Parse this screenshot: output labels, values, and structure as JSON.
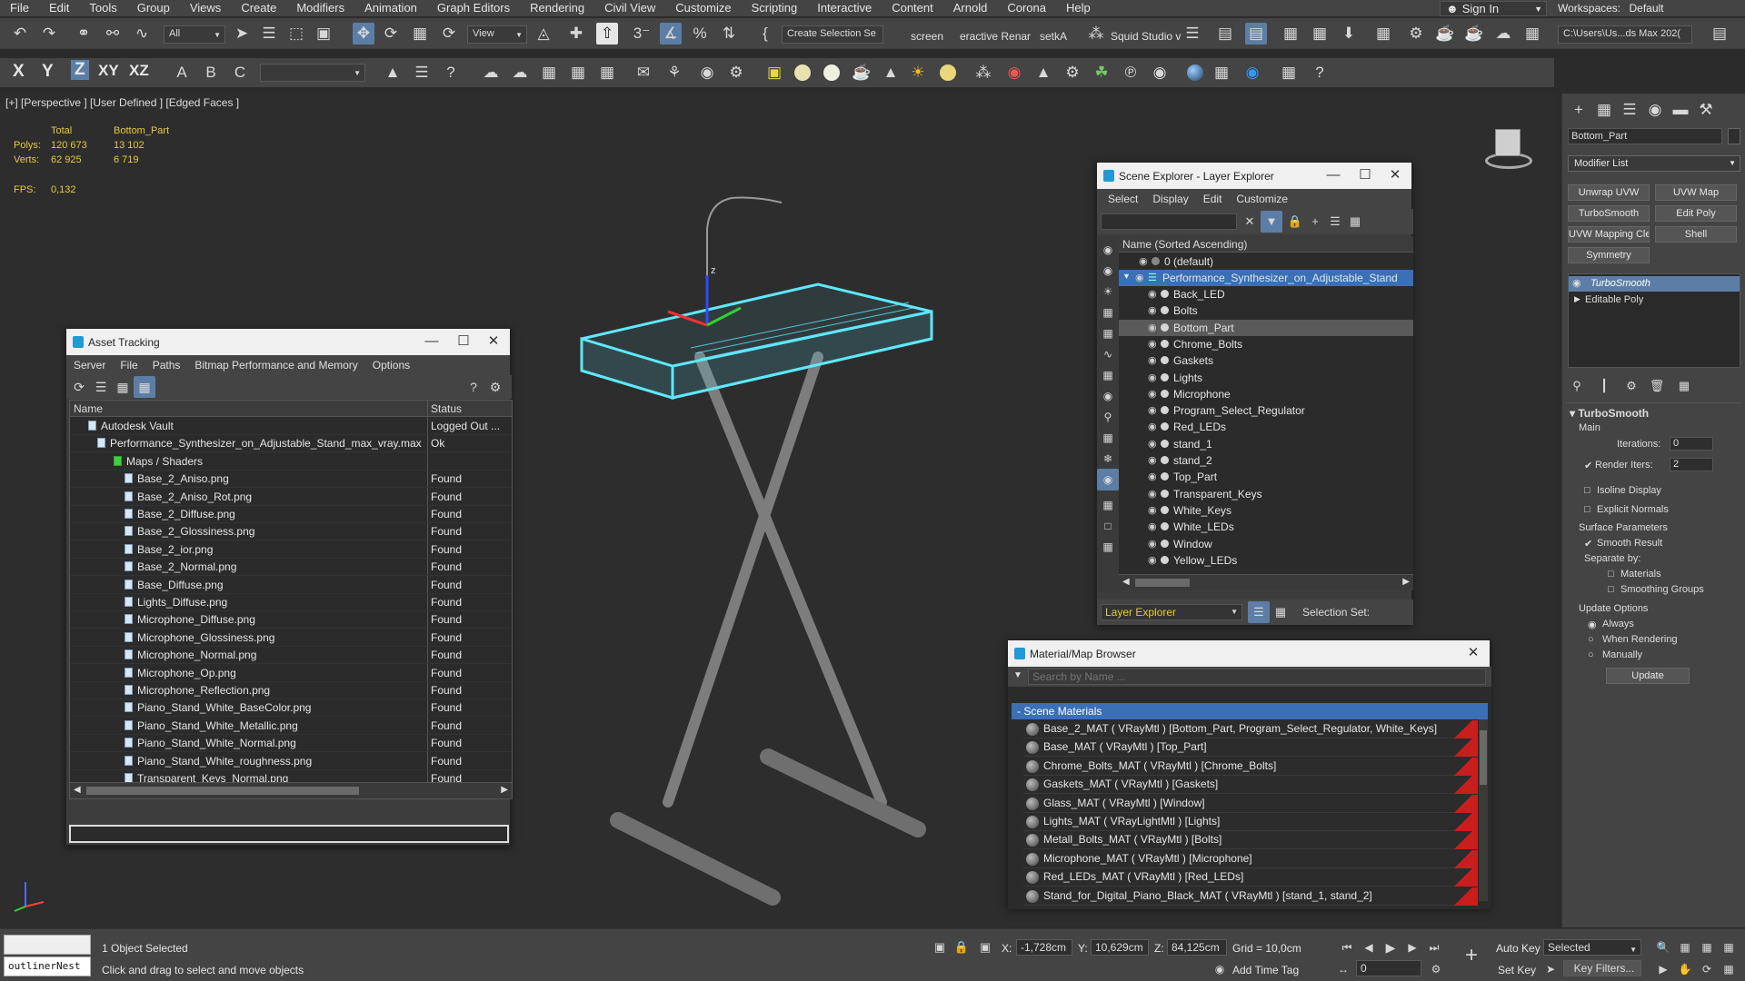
{
  "menubar": {
    "items": [
      "File",
      "Edit",
      "Tools",
      "Group",
      "Views",
      "Create",
      "Modifiers",
      "Animation",
      "Graph Editors",
      "Rendering",
      "Civil View",
      "Customize",
      "Scripting",
      "Interactive",
      "Content",
      "Arnold",
      "Corona",
      "Help"
    ],
    "sign_in": "Sign In",
    "workspaces_label": "Workspaces:",
    "workspace_value": "Default"
  },
  "toolbar": {
    "filter_dropdown": "All",
    "view_dropdown": "View",
    "selection_set": "Create Selection Se",
    "tab_screen": "screen",
    "tab_interactive": "eractive Renar",
    "tab_setka": "setkA",
    "squid_label": "Squid Studio v",
    "path_dropdown": "C:\\Users\\Us...ds Max 202(",
    "axis_x": "X",
    "axis_y": "Y",
    "axis_z": "Z",
    "axis_xy": "XY",
    "axis_xz": "XZ"
  },
  "viewport": {
    "label": "[+] [Perspective ] [User Defined ] [Edged Faces ]",
    "stats": {
      "total_header": "Total",
      "object_header": "Bottom_Part",
      "polys_label": "Polys:",
      "polys_total": "120 673",
      "polys_object": "13 102",
      "verts_label": "Verts:",
      "verts_total": "62 925",
      "verts_object": "6 719",
      "fps_label": "FPS:",
      "fps_value": "0,132"
    },
    "gizmo_z_label": "z",
    "keyboard_color": "#5ee8ff",
    "stand_color": "#8a8a8a"
  },
  "asset_tracking": {
    "title": "Asset Tracking",
    "menu": [
      "Server",
      "File",
      "Paths",
      "Bitmap Performance and Memory",
      "Options"
    ],
    "col_name": "Name",
    "col_status": "Status",
    "rows": [
      {
        "name": "Autodesk Vault",
        "status": "Logged Out ..."
      },
      {
        "name": "Performance_Synthesizer_on_Adjustable_Stand_max_vray.max",
        "status": "Ok"
      },
      {
        "name": "Maps / Shaders",
        "status": ""
      },
      {
        "name": "Base_2_Aniso.png",
        "status": "Found"
      },
      {
        "name": "Base_2_Aniso_Rot.png",
        "status": "Found"
      },
      {
        "name": "Base_2_Diffuse.png",
        "status": "Found"
      },
      {
        "name": "Base_2_Glossiness.png",
        "status": "Found"
      },
      {
        "name": "Base_2_ior.png",
        "status": "Found"
      },
      {
        "name": "Base_2_Normal.png",
        "status": "Found"
      },
      {
        "name": "Base_Diffuse.png",
        "status": "Found"
      },
      {
        "name": "Lights_Diffuse.png",
        "status": "Found"
      },
      {
        "name": "Microphone_Diffuse.png",
        "status": "Found"
      },
      {
        "name": "Microphone_Glossiness.png",
        "status": "Found"
      },
      {
        "name": "Microphone_Normal.png",
        "status": "Found"
      },
      {
        "name": "Microphone_Op.png",
        "status": "Found"
      },
      {
        "name": "Microphone_Reflection.png",
        "status": "Found"
      },
      {
        "name": "Piano_Stand_White_BaseColor.png",
        "status": "Found"
      },
      {
        "name": "Piano_Stand_White_Metallic.png",
        "status": "Found"
      },
      {
        "name": "Piano_Stand_White_Normal.png",
        "status": "Found"
      },
      {
        "name": "Piano_Stand_White_roughness.png",
        "status": "Found"
      },
      {
        "name": "Transparent_Keys_Normal.png",
        "status": "Found"
      }
    ]
  },
  "scene_explorer": {
    "title": "Scene Explorer - Layer Explorer",
    "menu": [
      "Select",
      "Display",
      "Edit",
      "Customize"
    ],
    "column_header": "Name (Sorted Ascending)",
    "default_layer": "0 (default)",
    "parent_layer": "Performance_Synthesizer_on_Adjustable_Stand",
    "children": [
      "Back_LED",
      "Bolts",
      "Bottom_Part",
      "Chrome_Bolts",
      "Gaskets",
      "Lights",
      "Microphone",
      "Program_Select_Regulator",
      "Red_LEDs",
      "stand_1",
      "stand_2",
      "Top_Part",
      "Transparent_Keys",
      "White_Keys",
      "White_LEDs",
      "Window",
      "Yellow_LEDs"
    ],
    "footer_dropdown": "Layer Explorer",
    "selection_set_label": "Selection Set:"
  },
  "material_browser": {
    "title": "Material/Map Browser",
    "search_placeholder": "Search by Name ...",
    "group_label": "- Scene Materials",
    "materials": [
      "Base_2_MAT  ( VRayMtl ) [Bottom_Part, Program_Select_Regulator, White_Keys]",
      "Base_MAT  ( VRayMtl ) [Top_Part]",
      "Chrome_Bolts_MAT  ( VRayMtl ) [Chrome_Bolts]",
      "Gaskets_MAT  ( VRayMtl ) [Gaskets]",
      "Glass_MAT  ( VRayMtl ) [Window]",
      "Lights_MAT  ( VRayLightMtl ) [Lights]",
      "Metall_Bolts_MAT  ( VRayMtl ) [Bolts]",
      "Microphone_MAT  ( VRayMtl ) [Microphone]",
      "Red_LEDs_MAT  ( VRayMtl ) [Red_LEDs]",
      "Stand_for_Digital_Piano_Black_MAT  ( VRayMtl ) [stand_1, stand_2]"
    ]
  },
  "command_panel": {
    "object_name": "Bottom_Part",
    "modifier_list": "Modifier List",
    "buttons": [
      "Unwrap UVW",
      "UVW Map",
      "TurboSmooth",
      "Edit Poly",
      "UVW Mapping Clear",
      "Shell",
      "Symmetry"
    ],
    "stack": [
      "TurboSmooth",
      "Editable Poly"
    ],
    "rollout_title": "TurboSmooth",
    "main_label": "Main",
    "iterations_label": "Iterations:",
    "iterations_value": "0",
    "render_iters_label": "Render Iters:",
    "render_iters_value": "2",
    "isoline": "Isoline Display",
    "explicit_normals": "Explicit Normals",
    "surface_params": "Surface Parameters",
    "smooth_result": "Smooth Result",
    "separate_by": "Separate by:",
    "materials": "Materials",
    "smoothing_groups": "Smoothing Groups",
    "update_options": "Update Options",
    "always": "Always",
    "when_rendering": "When Rendering",
    "manually": "Manually",
    "update_button": "Update"
  },
  "statusbar": {
    "outliner_field": "outlinerNest",
    "selection_text": "1 Object Selected",
    "prompt": "Click and drag to select and move objects",
    "x_label": "X:",
    "x_value": "-1,728cm",
    "y_label": "Y:",
    "y_value": "10,629cm",
    "z_label": "Z:",
    "z_value": "84,125cm",
    "grid": "Grid = 10,0cm",
    "add_time_tag": "Add Time Tag",
    "auto_key": "Auto Key",
    "set_key": "Set Key",
    "selected_dropdown": "Selected",
    "key_filters": "Key Filters...",
    "frame_value": "0"
  }
}
